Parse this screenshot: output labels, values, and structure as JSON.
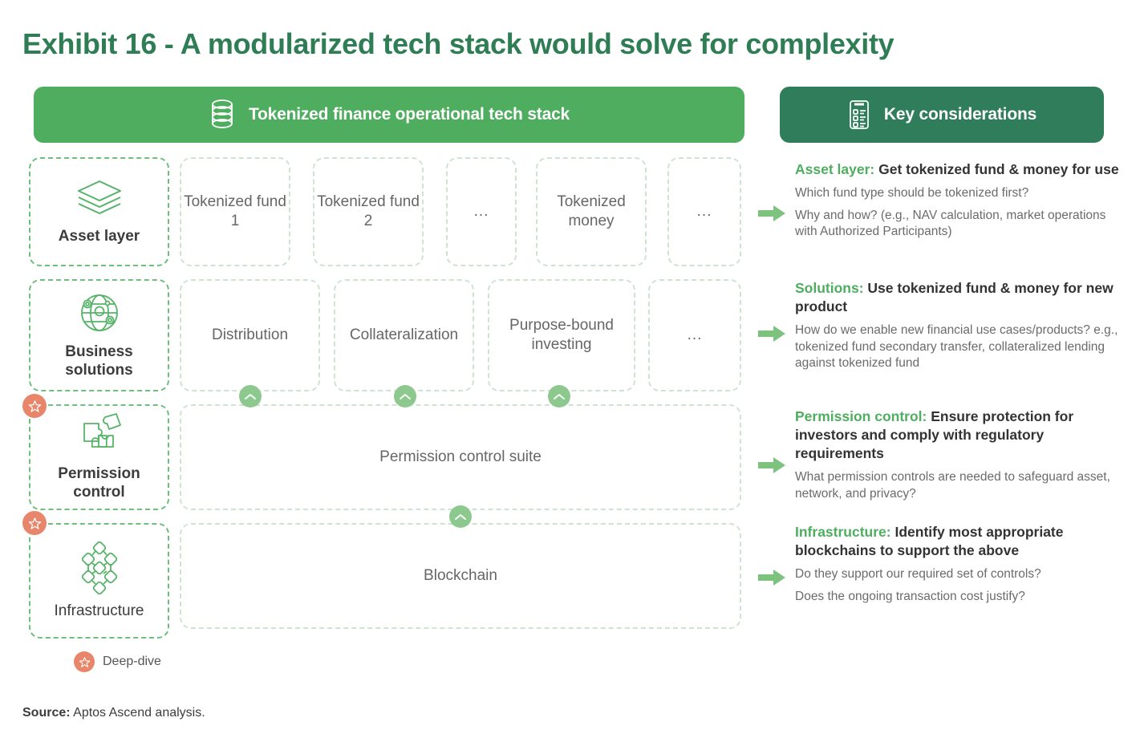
{
  "title": "Exhibit 16 - A modularized tech stack would solve for complexity",
  "colors": {
    "brand_green": "#4FAD5F",
    "dark_green": "#2F7D5B",
    "title_green": "#2e7d55",
    "chevron_green": "#8DC88F",
    "deep_dive_orange": "#E8866B",
    "dashed_label_border": "#6FBE7B",
    "dashed_item_border": "#cfe3d2"
  },
  "headers": {
    "left": {
      "label": "Tokenized finance operational tech stack",
      "icon": "database-icon"
    },
    "right": {
      "label": "Key considerations",
      "icon": "checklist-icon"
    }
  },
  "stack": {
    "rows": [
      {
        "id": "asset-layer",
        "label": "Asset layer",
        "icon": "layers-icon",
        "deep_dive": false,
        "items": [
          "Tokenized fund 1",
          "Tokenized fund 2",
          "...",
          "Tokenized money",
          "..."
        ]
      },
      {
        "id": "business-solutions",
        "label": "Business solutions",
        "icon": "globe-network-icon",
        "deep_dive": false,
        "items": [
          "Distribution",
          "Collateralization",
          "Purpose-bound investing",
          "..."
        ]
      },
      {
        "id": "permission-control",
        "label": "Permission control",
        "icon": "puzzle-icon",
        "deep_dive": true,
        "items": [
          "Permission control suite"
        ]
      },
      {
        "id": "infrastructure",
        "label": "Infrastructure",
        "icon": "blockchain-nodes-icon",
        "deep_dive": true,
        "items": [
          "Blockchain"
        ]
      }
    ]
  },
  "considerations": [
    {
      "lead": "Asset layer:",
      "head": " Get tokenized fund & money for use",
      "items": [
        "Which fund type should be tokenized first?",
        "Why and how? (e.g., NAV calculation, market operations with Authorized Participants)"
      ]
    },
    {
      "lead": "Solutions:",
      "head": " Use tokenized fund & money for new product",
      "items": [
        "How do we enable new financial use cases/products? e.g., tokenized fund secondary transfer, collateralized lending against tokenized fund"
      ]
    },
    {
      "lead": "Permission control:",
      "head": " Ensure protection for investors and comply with regulatory requirements",
      "items": [
        "What permission controls are needed to safeguard asset, network, and privacy?"
      ]
    },
    {
      "lead": "Infrastructure:",
      "head": " Identify most appropriate blockchains to support the above",
      "items": [
        "Do they support our required set of controls?",
        "Does the ongoing transaction cost justify?"
      ]
    }
  ],
  "legend": {
    "label": "Deep-dive",
    "icon": "star-badge-icon"
  },
  "source": {
    "label": "Source:",
    "text": " Aptos Ascend analysis."
  }
}
